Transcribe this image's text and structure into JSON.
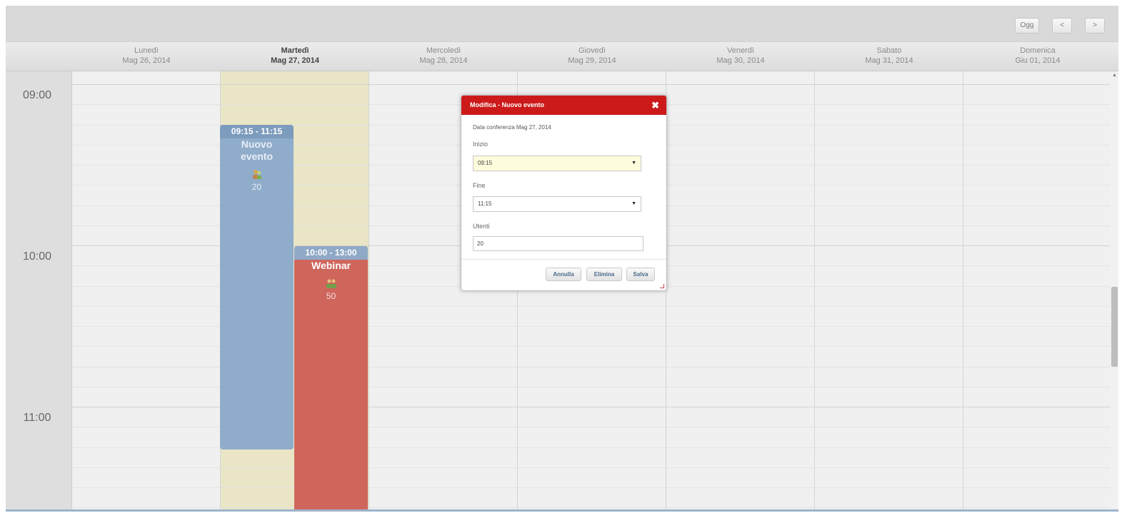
{
  "toolbar": {
    "today_label": "Ogg",
    "prev_label": "<",
    "next_label": ">"
  },
  "days": [
    {
      "name": "Lunedì",
      "date": "Mag 26, 2014",
      "today": false
    },
    {
      "name": "Martedì",
      "date": "Mag 27, 2014",
      "today": true
    },
    {
      "name": "Mercoledì",
      "date": "Mag 28, 2014",
      "today": false
    },
    {
      "name": "Giovedì",
      "date": "Mag 29, 2014",
      "today": false
    },
    {
      "name": "Venerdì",
      "date": "Mag 30, 2014",
      "today": false
    },
    {
      "name": "Sabato",
      "date": "Mag 31, 2014",
      "today": false
    },
    {
      "name": "Domenica",
      "date": "Giu 01, 2014",
      "today": false
    }
  ],
  "hours": [
    "09:00",
    "10:00",
    "11:00"
  ],
  "events": [
    {
      "time": "09:15 - 11:15",
      "title_line1": "Nuovo",
      "title_line2": "evento",
      "icon": "people-icon",
      "attendees": "20",
      "color": "#8faccb",
      "header_color": "#7d9bbd"
    },
    {
      "time": "10:00 - 13:00",
      "title_line1": "Webinar",
      "title_line2": "",
      "icon": "people-icon",
      "attendees": "50",
      "color": "#cf665c",
      "header_color": "#8fa9c7"
    }
  ],
  "dialog": {
    "title": "Modifica - Nuovo evento",
    "close_label": "✖",
    "conference_date": "Data conferenza Mag 27, 2014",
    "start_label": "Inizio",
    "start_value": "09:15",
    "end_label": "Fine",
    "end_value": "11:15",
    "users_label": "Utenti",
    "users_value": "20",
    "cancel_label": "Annulla",
    "delete_label": "Elimina",
    "save_label": "Salva",
    "title_color": "#cc1a1a",
    "start_bg_color": "#fdfcdc"
  },
  "colors": {
    "today_column": "#e9e5c5",
    "grid_background": "#f0f0f0"
  }
}
